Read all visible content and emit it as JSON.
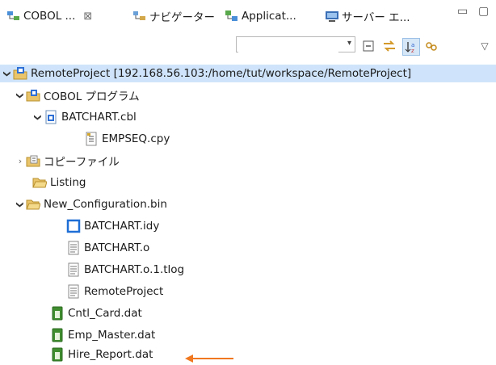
{
  "tabs": [
    {
      "label": "COBOL ...",
      "icon": "cobol-explorer-icon",
      "close": "⊠"
    },
    {
      "label": "ナビゲーター",
      "icon": "navigator-icon"
    },
    {
      "label": "Applicat...",
      "icon": "application-explorer-icon"
    },
    {
      "label": "サーバー エ...",
      "icon": "server-explorer-icon"
    }
  ],
  "window_buttons": {
    "minimize": "▭",
    "maximize": "▢"
  },
  "toolbar": {
    "filter_placeholder": "",
    "filter_dropdown": "▾",
    "buttons": [
      "collapse-all-icon",
      "link-with-editor-icon",
      "sort-alpha-icon",
      "filter-icon"
    ],
    "menu": "▽"
  },
  "tree": {
    "project": "RemoteProject [192.168.56.103:/home/tut/workspace/RemoteProject]",
    "cobol_programs": "COBOL プログラム",
    "batchart_cbl": "BATCHART.cbl",
    "empseq_cpy": "EMPSEQ.cpy",
    "copy_files": "コピーファイル",
    "listing": "Listing",
    "new_config": "New_Configuration.bin",
    "batchart_idy": "BATCHART.idy",
    "batchart_o": "BATCHART.o",
    "batchart_tlog": "BATCHART.o.1.tlog",
    "remote_project": "RemoteProject",
    "cntl_card": "Cntl_Card.dat",
    "emp_master": "Emp_Master.dat",
    "hire_report": "Hire_Report.dat"
  },
  "colors": {
    "selection": "#cfe4fa",
    "arrow": "#f07820",
    "folder": "#e9c46a",
    "project": "#2d6fd6"
  }
}
